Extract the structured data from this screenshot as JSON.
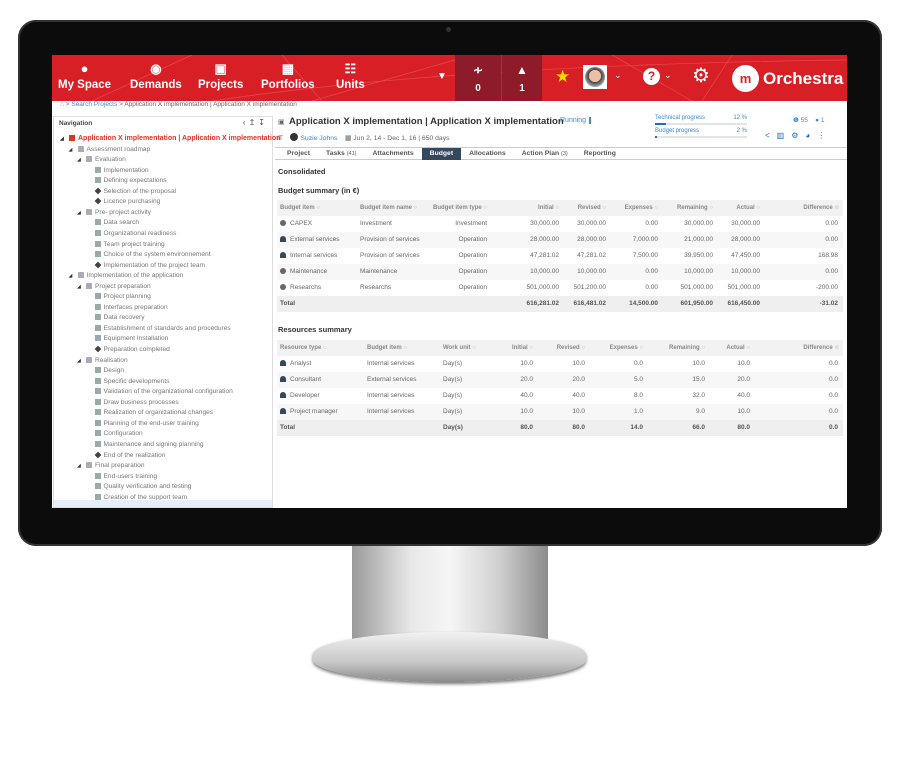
{
  "colors": {
    "brand": "#d81f26",
    "dark_header": "#8e1b2a",
    "link": "#3a8ad6",
    "active_tab": "#34495e"
  },
  "header": {
    "nav": [
      {
        "label": "My Space",
        "icon": "person-icon"
      },
      {
        "label": "Demands",
        "icon": "lightbulb-icon"
      },
      {
        "label": "Projects",
        "icon": "briefcase-icon"
      },
      {
        "label": "Portfolios",
        "icon": "portfolio-icon"
      },
      {
        "label": "Units",
        "icon": "org-chart-icon"
      }
    ],
    "feed_count": "0",
    "notif_count": "1",
    "logo": "Orchestra"
  },
  "breadcrumb": {
    "sep": ">",
    "link": "Search Projects",
    "current": "Application X implementation | Application X implementation"
  },
  "navigation": {
    "title": "Navigation",
    "tree": [
      {
        "label": "Application X implementation | Application X implementation",
        "level": 0,
        "type": "root"
      },
      {
        "label": "Assessment roadmap",
        "level": 1,
        "type": "folder"
      },
      {
        "label": "Evaluation",
        "level": 2,
        "type": "folder"
      },
      {
        "label": "Implementation",
        "level": 3,
        "type": "task"
      },
      {
        "label": "Defining expectations",
        "level": 3,
        "type": "task"
      },
      {
        "label": "Selection of the proposal",
        "level": 3,
        "type": "milestone"
      },
      {
        "label": "Licence purchasing",
        "level": 3,
        "type": "milestone"
      },
      {
        "label": "Pre- project activity",
        "level": 2,
        "type": "folder"
      },
      {
        "label": "Data search",
        "level": 3,
        "type": "task"
      },
      {
        "label": "Organizational readiness",
        "level": 3,
        "type": "task"
      },
      {
        "label": "Team project training",
        "level": 3,
        "type": "task"
      },
      {
        "label": "Choice of the system environnement",
        "level": 3,
        "type": "task"
      },
      {
        "label": "Implementation of the project team",
        "level": 3,
        "type": "milestone"
      },
      {
        "label": "Implementation of the application",
        "level": 1,
        "type": "folder"
      },
      {
        "label": "Project preparation",
        "level": 2,
        "type": "folder"
      },
      {
        "label": "Project planning",
        "level": 3,
        "type": "task"
      },
      {
        "label": "Interfaces preparation",
        "level": 3,
        "type": "task"
      },
      {
        "label": "Data recovery",
        "level": 3,
        "type": "task"
      },
      {
        "label": "Establishment of standards and procedures",
        "level": 3,
        "type": "task"
      },
      {
        "label": "Equipment Installation",
        "level": 3,
        "type": "task"
      },
      {
        "label": "Preparation completed",
        "level": 3,
        "type": "milestone"
      },
      {
        "label": "Realisation",
        "level": 2,
        "type": "folder"
      },
      {
        "label": "Design",
        "level": 3,
        "type": "task"
      },
      {
        "label": "Specific developments",
        "level": 3,
        "type": "task"
      },
      {
        "label": "Validation of the organizational configuration",
        "level": 3,
        "type": "task"
      },
      {
        "label": "Draw business processes",
        "level": 3,
        "type": "task"
      },
      {
        "label": "Realization of organizational changes",
        "level": 3,
        "type": "task"
      },
      {
        "label": "Planning of the end-user training",
        "level": 3,
        "type": "task"
      },
      {
        "label": "Configuration",
        "level": 3,
        "type": "task"
      },
      {
        "label": "Maintenance and signing planning",
        "level": 3,
        "type": "task"
      },
      {
        "label": "End of the realization",
        "level": 3,
        "type": "milestone"
      },
      {
        "label": "Final preparation",
        "level": 2,
        "type": "folder"
      },
      {
        "label": "End-users training",
        "level": 3,
        "type": "task"
      },
      {
        "label": "Quality verification and testing",
        "level": 3,
        "type": "task"
      },
      {
        "label": "Creation of the support team",
        "level": 3,
        "type": "task"
      }
    ]
  },
  "project": {
    "title": "Application X implementation | Application X implementation",
    "status": "Running",
    "unit": "IT",
    "manager": "Suzie Johns",
    "dates": "Jun 2, 14 - Dec 1, 16 | 650 days",
    "technical_progress": {
      "label": "Technical progress",
      "value": "12 %",
      "fraction": 0.12
    },
    "budget_progress": {
      "label": "Budget progress",
      "value": "2 %",
      "fraction": 0.02
    },
    "issues_count": "55",
    "comments_count": "1"
  },
  "tabs": [
    {
      "label": "Project",
      "count": ""
    },
    {
      "label": "Tasks",
      "count": "(41)"
    },
    {
      "label": "Attachments",
      "count": ""
    },
    {
      "label": "Budget",
      "count": "",
      "active": true
    },
    {
      "label": "Allocations",
      "count": ""
    },
    {
      "label": "Action Plan",
      "count": "(3)"
    },
    {
      "label": "Reporting",
      "count": ""
    }
  ],
  "consolidated": "Consolidated",
  "budget": {
    "title": "Budget summary (in €)",
    "columns": [
      "Budget item",
      "Budget item name",
      "Budget item type",
      "Initial",
      "Revised",
      "Expenses",
      "Remaining",
      "Actual",
      "Difference"
    ],
    "rows": [
      {
        "icon": "coin",
        "cells": [
          "CAPEX",
          "Investment",
          "Investment",
          "30,000.00",
          "30,000.00",
          "0.00",
          "30,000.00",
          "30,000.00",
          "0.00"
        ]
      },
      {
        "icon": "person",
        "cells": [
          "External services",
          "Provision of services",
          "Operation",
          "28,000.00",
          "28,000.00",
          "7,000.00",
          "21,000.00",
          "28,000.00",
          "0.00"
        ]
      },
      {
        "icon": "person",
        "cells": [
          "Internal services",
          "Provision of services",
          "Operation",
          "47,281.02",
          "47,281.02",
          "7,500.00",
          "39,950.00",
          "47,450.00",
          "168.98"
        ]
      },
      {
        "icon": "coin",
        "cells": [
          "Maintenance",
          "Maintenance",
          "Operation",
          "10,000.00",
          "10,000.00",
          "0.00",
          "10,000.00",
          "10,000.00",
          "0.00"
        ]
      },
      {
        "icon": "coin",
        "cells": [
          "Researchs",
          "Researchs",
          "Operation",
          "501,000.00",
          "501,200.00",
          "0.00",
          "501,000.00",
          "501,000.00",
          "-200.00"
        ]
      }
    ],
    "total": [
      "Total",
      "",
      "",
      "616,281.02",
      "616,481.02",
      "14,500.00",
      "601,950.00",
      "616,450.00",
      "-31.02"
    ]
  },
  "resources": {
    "title": "Resources summary",
    "columns": [
      "Resource type",
      "Budget item",
      "Work unit",
      "Initial",
      "Revised",
      "Expenses",
      "Remaining",
      "Actual",
      "Difference"
    ],
    "rows": [
      {
        "icon": "person",
        "cells": [
          "Analyst",
          "Internal services",
          "Day(s)",
          "10.0",
          "10.0",
          "0.0",
          "10.0",
          "10.0",
          "0.0"
        ]
      },
      {
        "icon": "person",
        "cells": [
          "Consultant",
          "External services",
          "Day(s)",
          "20.0",
          "20.0",
          "5.0",
          "15.0",
          "20.0",
          "0.0"
        ]
      },
      {
        "icon": "person",
        "cells": [
          "Developer",
          "Internal services",
          "Day(s)",
          "40.0",
          "40.0",
          "8.0",
          "32.0",
          "40.0",
          "0.0"
        ]
      },
      {
        "icon": "person",
        "cells": [
          "Project manager",
          "Internal services",
          "Day(s)",
          "10.0",
          "10.0",
          "1.0",
          "9.0",
          "10.0",
          "0.0"
        ]
      }
    ],
    "total": [
      "Total",
      "",
      "Day(s)",
      "80.0",
      "80.0",
      "14.0",
      "66.0",
      "80.0",
      "0.0"
    ]
  }
}
